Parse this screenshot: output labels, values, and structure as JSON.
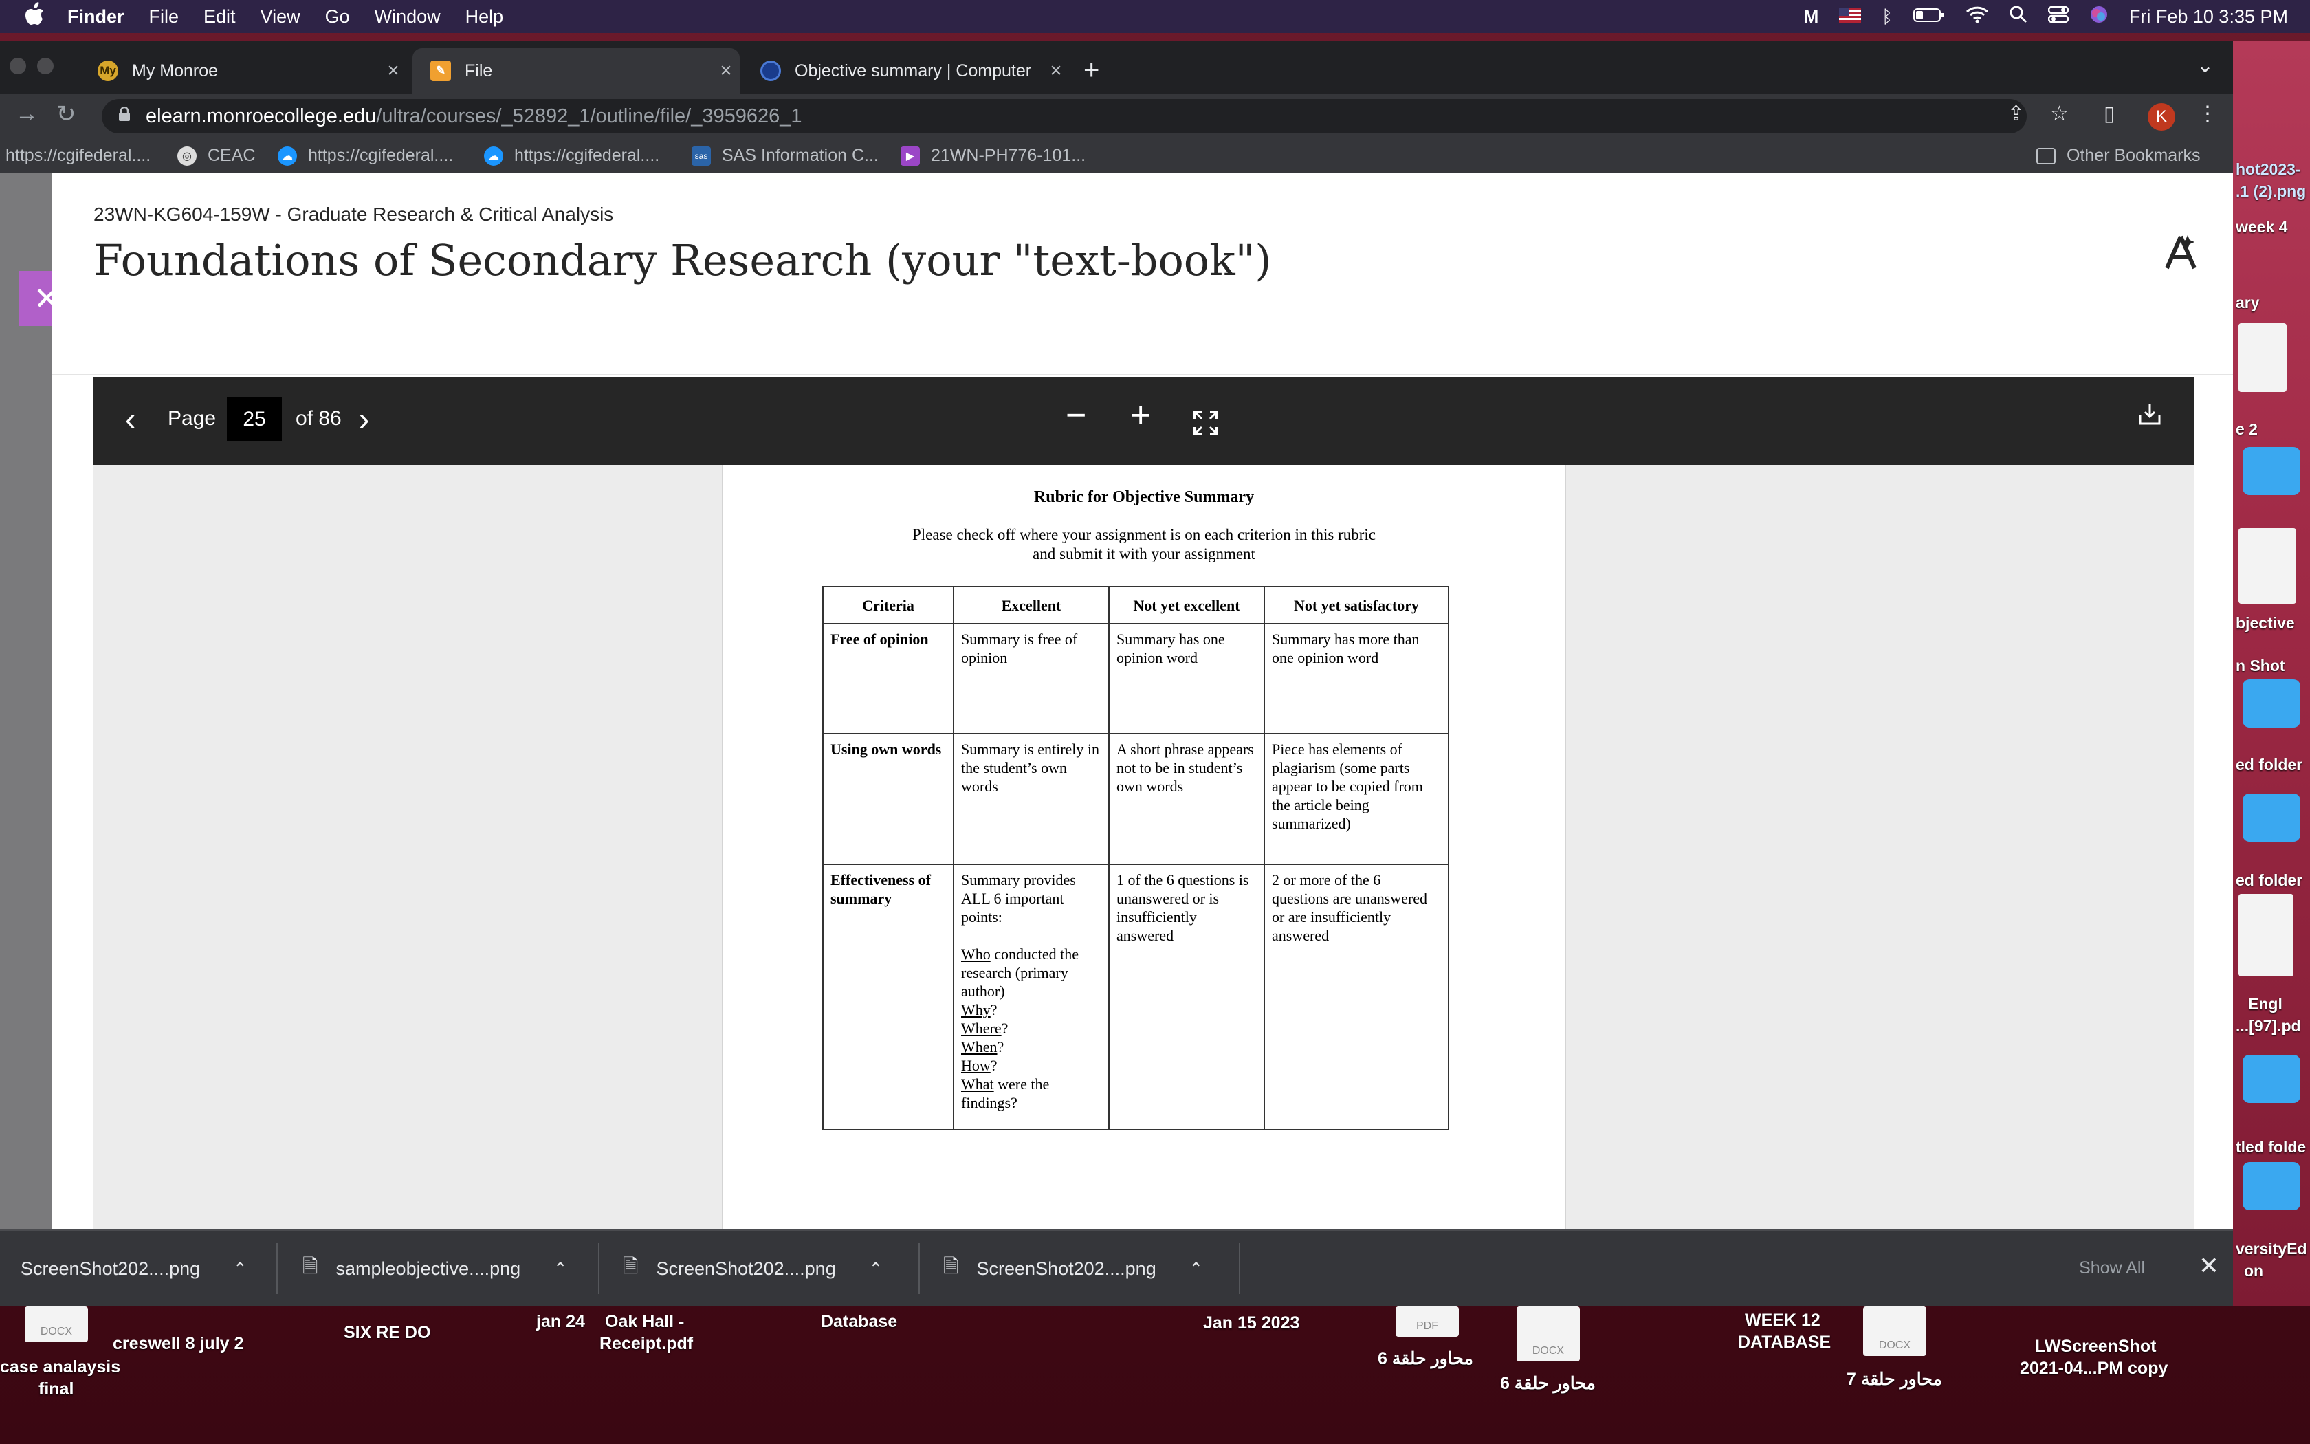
{
  "menubar": {
    "app": "Finder",
    "items": [
      "File",
      "Edit",
      "View",
      "Go",
      "Window",
      "Help"
    ],
    "clock": "Fri Feb 10  3:35 PM"
  },
  "tabs": [
    {
      "title": "My Monroe",
      "favicon": "My"
    },
    {
      "title": "File",
      "favicon": ""
    },
    {
      "title": "Objective summary | Computer",
      "favicon": ""
    }
  ],
  "address": {
    "host": "elearn.monroecollege.edu",
    "path": "/ultra/courses/_52892_1/outline/file/_3959626_1"
  },
  "profile_initial": "K",
  "bookmarks": [
    "https://cgifederal....",
    "CEAC",
    "https://cgifederal....",
    "https://cgifederal....",
    "SAS Information C...",
    "21WN-PH776-101...",
    "Other Bookmarks"
  ],
  "page": {
    "course": "23WN-KG604-159W - Graduate Research & Critical Analysis",
    "title": "Foundations of Secondary Research (your \"text-book\")"
  },
  "viewer": {
    "page_label": "Page",
    "page_number": "25",
    "page_total": "of 86"
  },
  "document": {
    "heading": "Rubric for Objective Summary",
    "instruction_line1": "Please check off where your assignment is on each criterion in this rubric",
    "instruction_line2": "and submit it with your assignment",
    "columns": [
      "Criteria",
      "Excellent",
      "Not yet excellent",
      "Not yet satisfactory"
    ],
    "rows": [
      {
        "criteria": "Free of opinion",
        "excellent": "Summary is free of opinion",
        "not_yet_excellent": "Summary has one opinion word",
        "not_yet_satisfactory": "Summary has more than one opinion word"
      },
      {
        "criteria": "Using own words",
        "excellent": "Summary is entirely in the student’s own words",
        "not_yet_excellent": "A short phrase appears not to be in student’s own words",
        "not_yet_satisfactory": "Piece has elements of plagiarism (some parts appear to be copied from the article being summarized)"
      },
      {
        "criteria": "Effectiveness of summary",
        "excellent_intro": "Summary provides ALL 6 important points:",
        "q_who": "Who",
        "q_who_rest": " conducted the research (primary author)",
        "q_why": "Why",
        "q_where": "Where",
        "q_when": "When",
        "q_how": "How",
        "q_what": "What",
        "q_what_rest": " were the findings?",
        "not_yet_excellent": "1 of the 6 questions is unanswered or is insufficiently answered",
        "not_yet_satisfactory": "2 or more of the 6 questions are unanswered or are insufficiently answered"
      }
    ]
  },
  "downloads": [
    "ScreenShot202....png",
    "sampleobjective....png",
    "ScreenShot202....png",
    "ScreenShot202....png"
  ],
  "downloads_show_all": "Show All",
  "desktop": {
    "right_labels": [
      "hot2023-",
      ".1 (2).png",
      "week 4",
      "ary",
      "e 2",
      "bjective",
      "n Shot",
      "ed folder",
      "ed folder",
      "Engl",
      "...[97].pd",
      "tled folde",
      "versityEd",
      "on"
    ],
    "bottom_labels": [
      "case analaysis",
      "final",
      "creswell 8 july 2",
      "SIX RE DO",
      "jan 24",
      "Oak Hall -",
      "Receipt.pdf",
      "Database",
      "Jan 15 2023",
      "محاور حلقة 6",
      "محاور حلقة 6",
      "WEEK 12",
      "DATABASE",
      "محاور حلقة 7",
      "LWScreenShot",
      "2021-04...PM copy"
    ],
    "file_badges": [
      "DOCX",
      "PDF",
      "DOCX",
      "DOCX"
    ]
  }
}
